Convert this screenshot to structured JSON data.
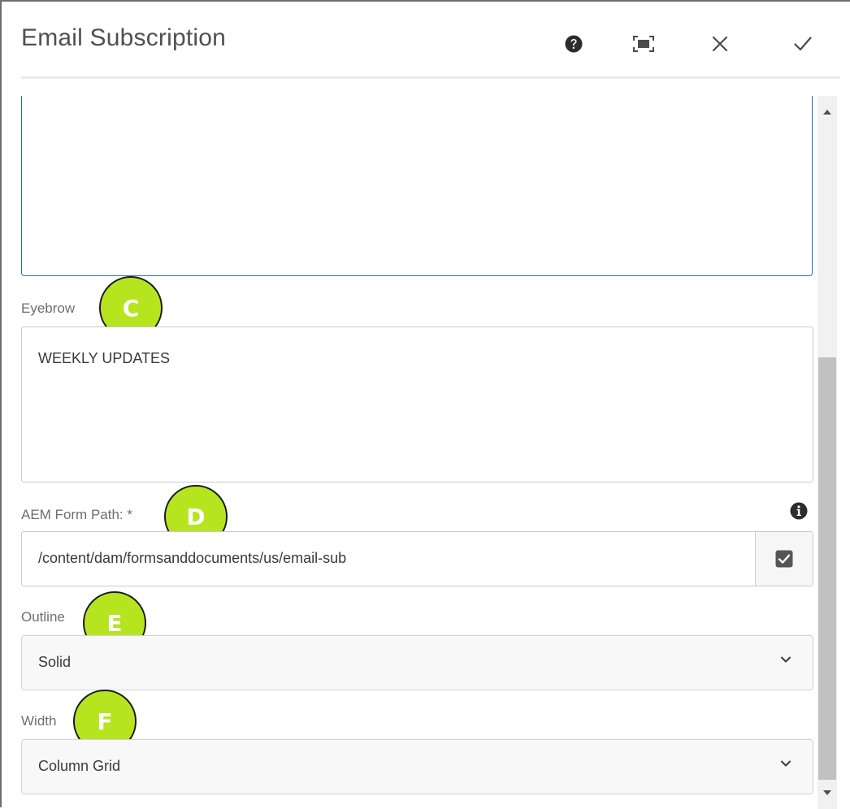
{
  "dialog": {
    "title": "Email Subscription",
    "icons": {
      "help": "help-icon",
      "fullscreen": "fullscreen-icon",
      "close": "close-icon",
      "confirm": "check-icon"
    }
  },
  "form": {
    "eyebrow": {
      "label": "Eyebrow",
      "value": "WEEKLY UPDATES"
    },
    "form_path": {
      "label": "AEM Form Path: *",
      "value": "/content/dam/formsanddocuments/us/email-sub"
    },
    "outline": {
      "label": "Outline",
      "selected": "Solid"
    },
    "width": {
      "label": "Width",
      "selected": "Column Grid"
    }
  },
  "annotations": [
    "C",
    "D",
    "E",
    "F"
  ],
  "colors": {
    "badge": "#b6e51f",
    "focus_border": "#2d6ad6"
  }
}
